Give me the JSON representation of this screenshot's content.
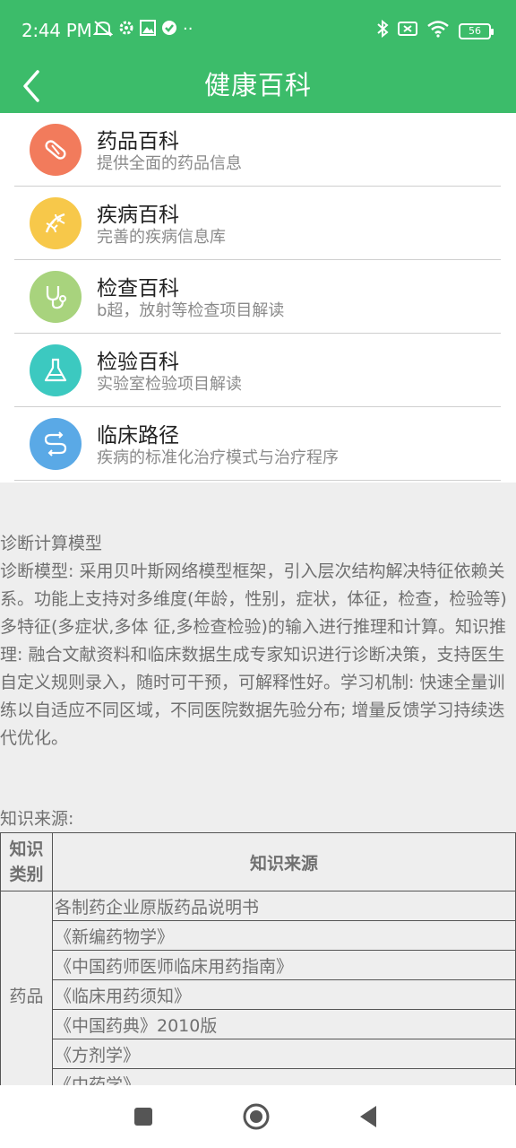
{
  "status": {
    "time": "2:44 PM",
    "battery": "56"
  },
  "header": {
    "title": "健康百科",
    "back_icon": "chevron-left-icon"
  },
  "menu": [
    {
      "title": "药品百科",
      "subtitle": "提供全面的药品信息",
      "icon": "pill-icon",
      "color": "#f27b5c"
    },
    {
      "title": "疾病百科",
      "subtitle": "完善的疾病信息库",
      "icon": "dna-icon",
      "color": "#f7c84a"
    },
    {
      "title": "检查百科",
      "subtitle": "b超，放射等检查项目解读",
      "icon": "stethoscope-icon",
      "color": "#a8d37d"
    },
    {
      "title": "检验百科",
      "subtitle": "实验室检验项目解读",
      "icon": "flask-icon",
      "color": "#3cc9c0"
    },
    {
      "title": "临床路径",
      "subtitle": "疾病的标准化治疗模式与治疗程序",
      "icon": "path-icon",
      "color": "#5aa9e6"
    }
  ],
  "model": {
    "title": "诊断计算模型",
    "body": "诊断模型: 采用贝叶斯网络模型框架，引入层次结构解决特征依赖关系。功能上支持对多维度(年龄，性别，症状，体征，检查，检验等)多特征(多症状,多体 征,多检查检验)的输入进行推理和计算。知识推理: 融合文献资料和临床数据生成专家知识进行诊断决策，支持医生自定义规则录入，随时可干预，可解释性好。学习机制: 快速全量训练以自适应不同区域，不同医院数据先验分布; 增量反馈学习持续迭代优化。"
  },
  "sources": {
    "title": "知识来源:",
    "header_category": "知识类别",
    "header_source": "知识来源",
    "category": "药品",
    "rows": [
      "各制药企业原版药品说明书",
      "《新编药物学》",
      "《中国药师医师临床用药指南》",
      "《临床用药须知》",
      "《中国药典》2010版",
      "《方剂学》",
      "《中药学》"
    ]
  },
  "nav": {
    "recent": "square-icon",
    "home": "circle-icon",
    "back": "triangle-back-icon"
  },
  "colors": {
    "primary": "#3cbc6a"
  }
}
